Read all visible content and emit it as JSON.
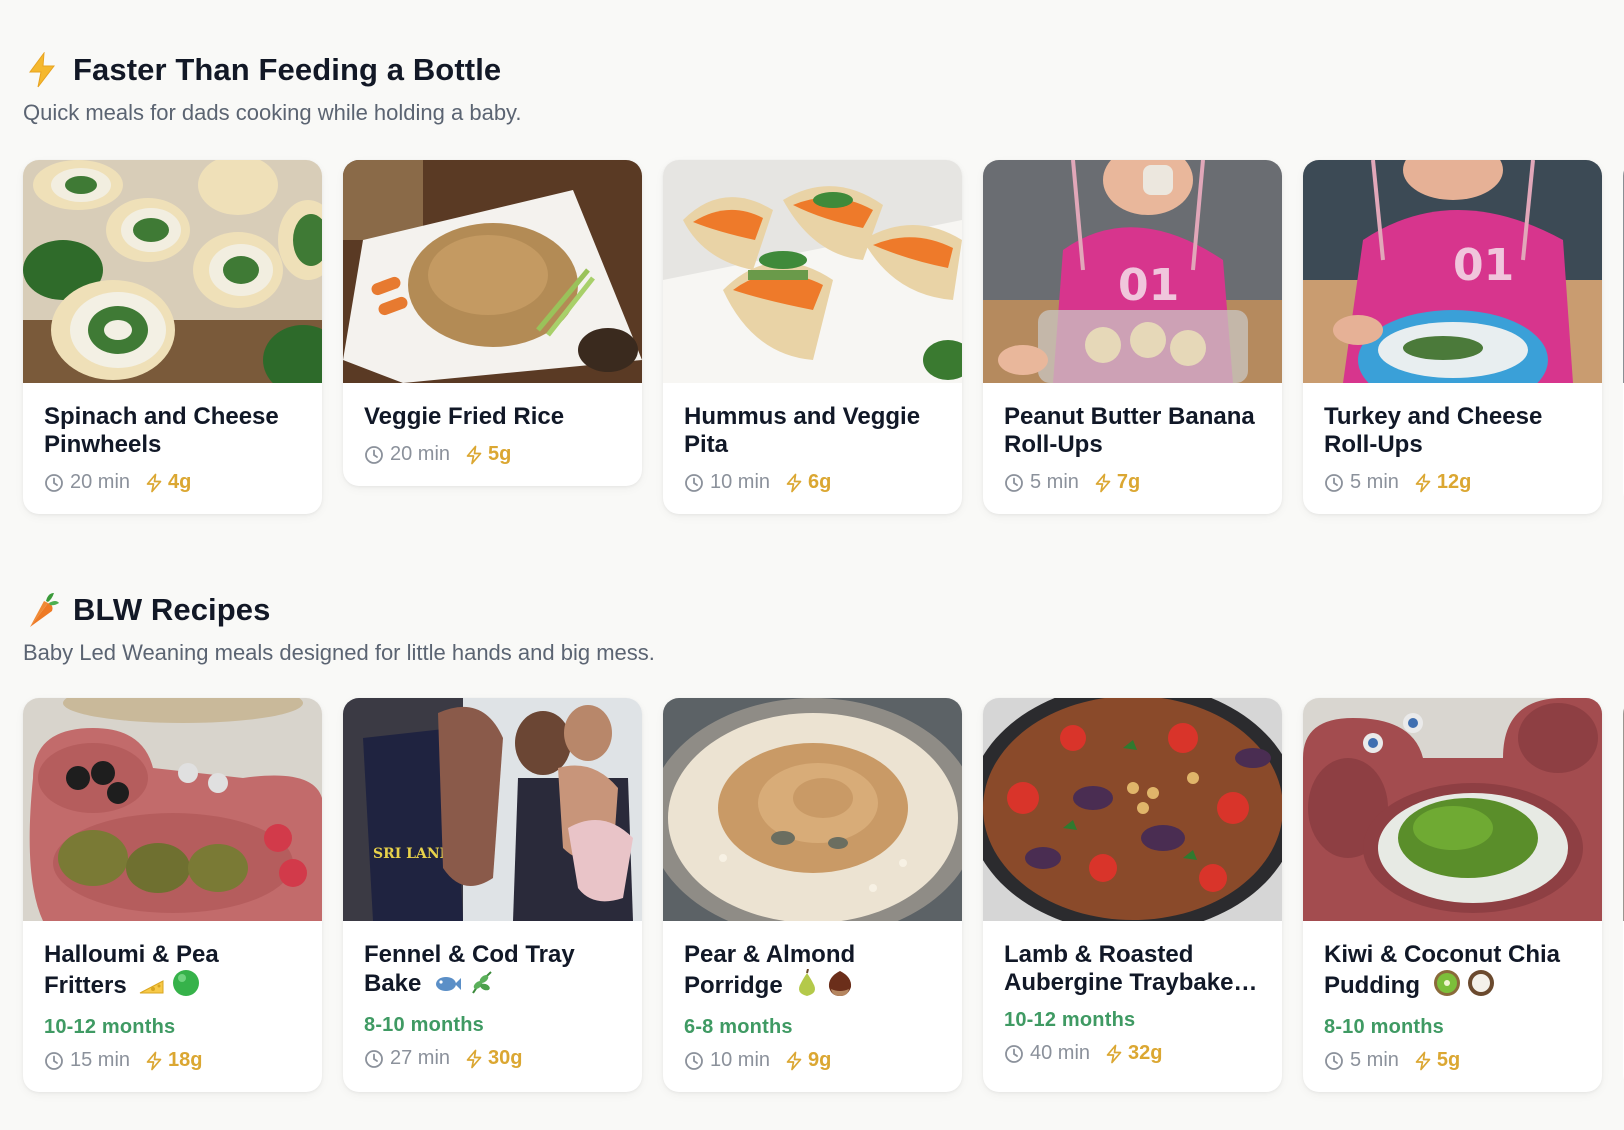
{
  "sections": [
    {
      "icon": "lightning-icon",
      "title": "Faster Than Feeding a Bottle",
      "subtitle": "Quick meals for dads cooking while holding a baby.",
      "cards": [
        {
          "title": "Spinach and Cheese Pinwheels",
          "time": "20 min",
          "protein": "4g",
          "image": "pinwheels-photo"
        },
        {
          "title": "Veggie Fried Rice",
          "time": "20 min",
          "protein": "5g",
          "image": "fried-rice-photo"
        },
        {
          "title": "Hummus and Veggie Pita",
          "time": "10 min",
          "protein": "6g",
          "image": "pita-photo"
        },
        {
          "title": "Peanut Butter Banana Roll-Ups",
          "time": "5 min",
          "protein": "7g",
          "image": "baby-rollups-photo"
        },
        {
          "title": "Turkey and Cheese Roll-Ups",
          "time": "5 min",
          "protein": "12g",
          "image": "baby-bowl-photo"
        }
      ]
    },
    {
      "icon": "carrot-icon",
      "title": "BLW Recipes",
      "subtitle": "Baby Led Weaning meals designed for little hands and big mess.",
      "cards": [
        {
          "title": "Halloumi & Pea Fritters",
          "emojis": [
            "cheese-emoji",
            "green-circle-emoji"
          ],
          "age": "10-12 months",
          "time": "15 min",
          "protein": "18g",
          "image": "fritters-photo"
        },
        {
          "title": "Fennel & Cod Tray Bake",
          "emojis": [
            "fish-emoji",
            "herb-emoji"
          ],
          "age": "8-10 months",
          "time": "27 min",
          "protein": "30g",
          "image": "family-fish-photo"
        },
        {
          "title": "Pear & Almond Porridge",
          "emojis": [
            "pear-emoji",
            "chestnut-emoji"
          ],
          "age": "6-8 months",
          "time": "10 min",
          "protein": "9g",
          "image": "porridge-photo"
        },
        {
          "title": "Lamb & Roasted Aubergine Traybake…",
          "emojis": [],
          "age": "10-12 months",
          "time": "40 min",
          "protein": "32g",
          "image": "traybake-photo"
        },
        {
          "title": "Kiwi & Coconut Chia Pudding",
          "emojis": [
            "kiwi-emoji",
            "coconut-emoji"
          ],
          "age": "8-10 months",
          "time": "5 min",
          "protein": "5g",
          "image": "chia-pudding-photo"
        }
      ]
    }
  ],
  "colors": {
    "background": "#f9f9f7",
    "card": "#ffffff",
    "title": "#111827",
    "subtitle": "#5b6472",
    "muted": "#8b919b",
    "protein": "#dba732",
    "age": "#3f9a63"
  }
}
